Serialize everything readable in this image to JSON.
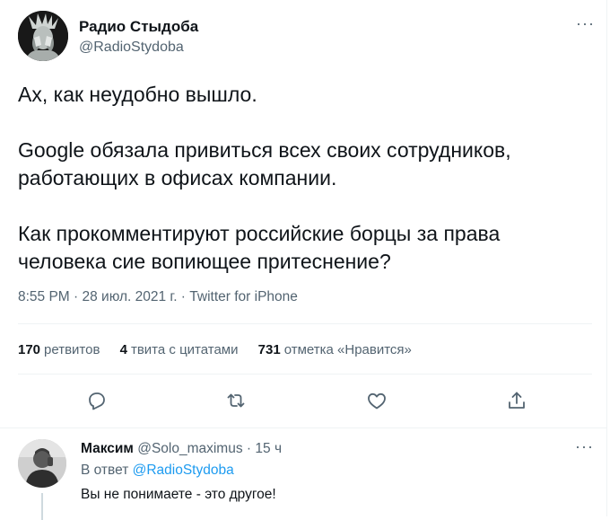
{
  "tweet": {
    "author_name": "Радио Стыдоба",
    "author_handle": "@RadioStydoba",
    "more_label": "···",
    "paragraphs": [
      "Ах, как неудобно вышло.",
      "Google обязала привиться всех своих сотрудников, работающих в офисах компании.",
      "Как прокомментируют российские борцы за права человека сие вопиющее притеснение?"
    ],
    "meta": "8:55 PM · 28 июл. 2021 г. · Twitter for iPhone"
  },
  "stats": {
    "retweets_count": "170",
    "retweets_label": "ретвитов",
    "quotes_count": "4",
    "quotes_label": "твита с цитатами",
    "likes_count": "731",
    "likes_label": "отметка «Нравится»"
  },
  "actions": [
    {
      "icon": "reply-icon"
    },
    {
      "icon": "retweet-icon"
    },
    {
      "icon": "like-icon"
    },
    {
      "icon": "share-icon"
    }
  ],
  "reply": {
    "author_name": "Максим",
    "author_handle": "@Solo_maximus",
    "time": "15 ч",
    "more_label": "···",
    "reply_prefix": "В ответ",
    "reply_to": "@RadioStydoba",
    "text": "Вы не понимаете - это другое!"
  },
  "colors": {
    "text": "#0f1419",
    "secondary": "#536471",
    "link": "#1d9bf0",
    "divider": "#eff3f4"
  }
}
